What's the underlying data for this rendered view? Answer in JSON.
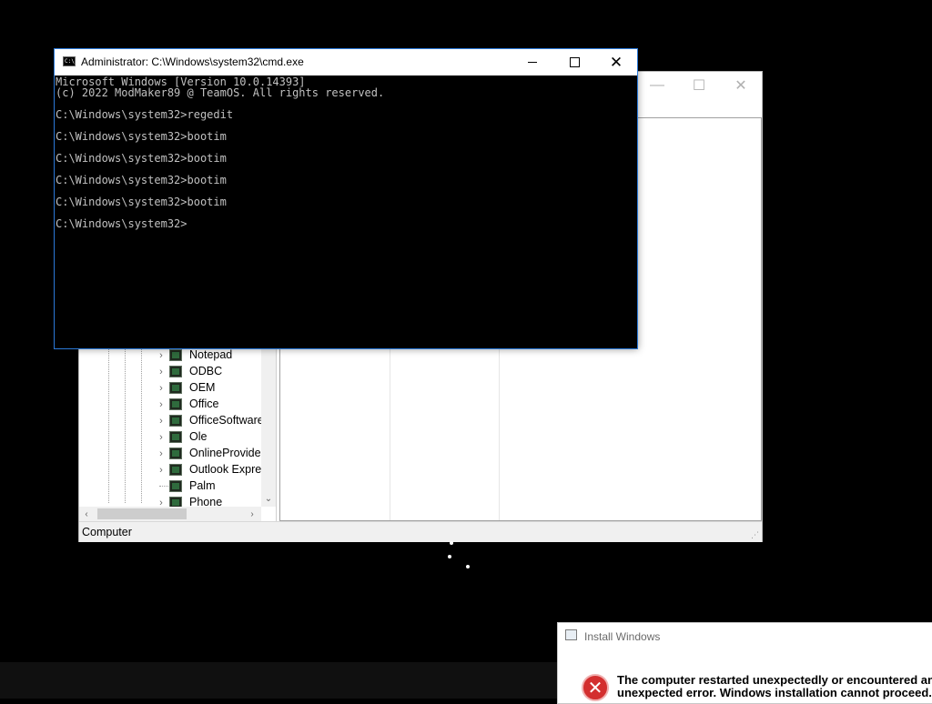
{
  "regedit": {
    "controls": {
      "minimize": "—",
      "maximize": "☐",
      "close": "✕"
    },
    "tree_items": [
      {
        "label": "Notepad"
      },
      {
        "label": "ODBC"
      },
      {
        "label": "OEM"
      },
      {
        "label": "Office"
      },
      {
        "label": "OfficeSoftware"
      },
      {
        "label": "Ole"
      },
      {
        "label": "OnlineProvide"
      },
      {
        "label": "Outlook Expres"
      },
      {
        "label": "Palm",
        "leaf": true
      },
      {
        "label": "Phone"
      }
    ],
    "status": "Computer"
  },
  "cmd": {
    "title": "Administrator: C:\\Windows\\system32\\cmd.exe",
    "icon_text": "C:\\",
    "lines": [
      "Microsoft Windows [Version 10.0.14393]",
      "(c) 2022 ModMaker89 @ TeamOS. All rights reserved.",
      "",
      "C:\\Windows\\system32>regedit",
      "",
      "C:\\Windows\\system32>bootim",
      "",
      "C:\\Windows\\system32>bootim",
      "",
      "C:\\Windows\\system32>bootim",
      "",
      "C:\\Windows\\system32>bootim",
      "",
      "C:\\Windows\\system32>"
    ]
  },
  "install": {
    "title": "Install Windows",
    "message_line1": "The computer restarted unexpectedly or encountered an",
    "message_line2": "unexpected error. Windows installation cannot proceed."
  }
}
